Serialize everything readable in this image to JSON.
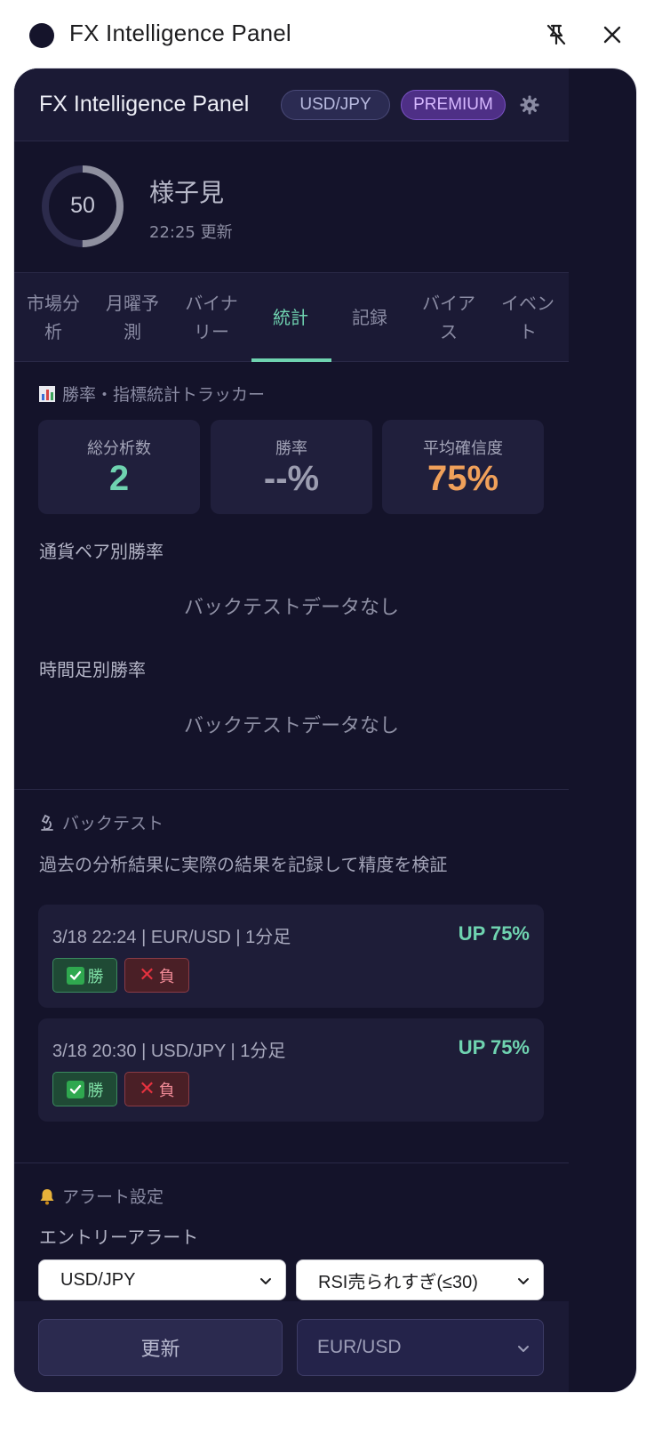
{
  "outer": {
    "title": "FX Intelligence Panel",
    "pin_icon": "unpin-icon",
    "close_icon": "close-icon"
  },
  "header": {
    "title": "FX Intelligence Panel",
    "pair_badge": "USD/JPY",
    "plan_badge": "PREMIUM",
    "settings_icon": "gear-icon"
  },
  "signal": {
    "score": "50",
    "score_fraction": 0.5,
    "label": "様子見",
    "updated": "22:25 更新"
  },
  "tabs": [
    {
      "label": "市場分析",
      "lines": [
        "市場分",
        "析"
      ]
    },
    {
      "label": "月曜予測",
      "lines": [
        "月曜予",
        "測"
      ]
    },
    {
      "label": "バイナリー",
      "lines": [
        "バイナ",
        "リー"
      ]
    },
    {
      "label": "統計",
      "lines": [
        "統計"
      ],
      "active": true
    },
    {
      "label": "記録",
      "lines": [
        "記録"
      ]
    },
    {
      "label": "バイアス",
      "lines": [
        "バイア",
        "ス"
      ]
    },
    {
      "label": "イベント",
      "lines": [
        "イベン",
        "ト"
      ]
    }
  ],
  "stats": {
    "section_icon": "bar-chart-icon",
    "section_title": "勝率・指標統計トラッカー",
    "cards": [
      {
        "label": "総分析数",
        "value": "2",
        "color": "#6fd3b0"
      },
      {
        "label": "勝率",
        "value": "--%",
        "color": "#9c9db0"
      },
      {
        "label": "平均確信度",
        "value": "75%",
        "color": "#f0a05a"
      }
    ],
    "by_pair_title": "通貨ペア別勝率",
    "by_pair_empty": "バックテストデータなし",
    "by_timeframe_title": "時間足別勝率",
    "by_timeframe_empty": "バックテストデータなし"
  },
  "backtest": {
    "section_icon": "microscope-icon",
    "section_title": "バックテスト",
    "description": "過去の分析結果に実際の結果を記録して精度を検証",
    "entries": [
      {
        "info": "3/18 22:24 | EUR/USD | 1分足",
        "direction": "UP 75%",
        "win_label": "勝",
        "lose_label": "負"
      },
      {
        "info": "3/18 20:30 | USD/JPY | 1分足",
        "direction": "UP 75%",
        "win_label": "勝",
        "lose_label": "負"
      }
    ]
  },
  "alerts": {
    "section_icon": "bell-icon",
    "section_title": "アラート設定",
    "entry_title": "エントリーアラート",
    "pair_select": "USD/JPY",
    "condition_select": "RSI売られすぎ(≤30)"
  },
  "footer": {
    "update_label": "更新",
    "pair_select": "EUR/USD"
  },
  "colors": {
    "panel_bg": "#14132a",
    "accent_green": "#6fd3b0",
    "accent_orange": "#f0a05a",
    "premium": "#4e2f86"
  }
}
